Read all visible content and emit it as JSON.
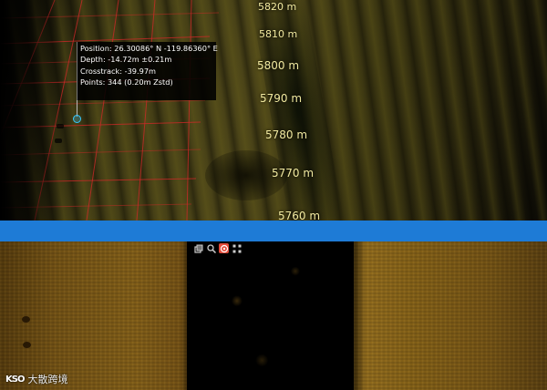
{
  "sonar_3d_view": {
    "depth_markers": [
      "5820 m",
      "5810 m",
      "5800 m",
      "5790 m",
      "5780 m",
      "5770 m",
      "5760 m"
    ],
    "info_tooltip": {
      "position": "Position: 26.30086° N -119.86360° E",
      "depth": "Depth: -14.72m ±0.21m",
      "crosstrack": "Crosstrack: -39.97m",
      "points": "Points: 344  (0.20m Zstd)"
    }
  },
  "sidescan_view": {
    "toolbar": {
      "buttons": [
        {
          "icon": "copy-icon"
        },
        {
          "icon": "zoom-icon"
        },
        {
          "icon": "target-icon",
          "active": true
        },
        {
          "icon": "fit-icon"
        }
      ]
    }
  },
  "watermark": {
    "logo": "KSO",
    "text": "大散跨境"
  },
  "colors": {
    "divider": "#1e7bd6",
    "active_tool": "#e24b3a",
    "marker": "#36c8ff"
  }
}
